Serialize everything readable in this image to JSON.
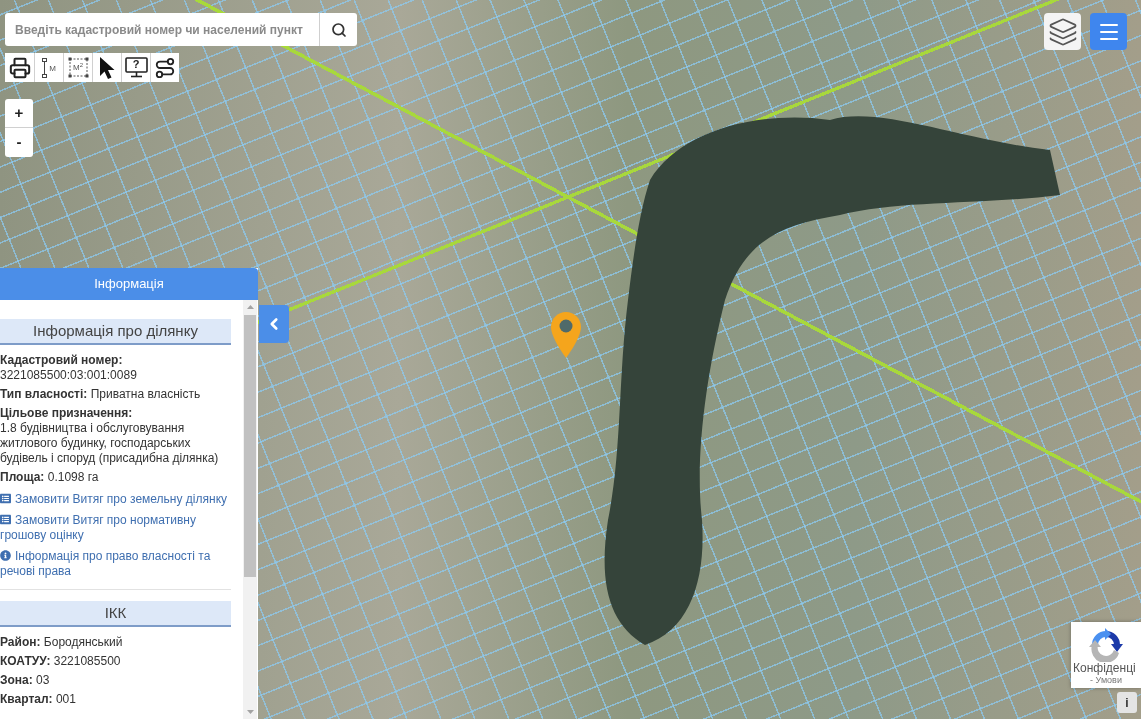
{
  "search": {
    "placeholder": "Введіть кадастровий номер чи населений пункт"
  },
  "tools": [
    {
      "kind": "print"
    },
    {
      "kind": "distance",
      "label": "M"
    },
    {
      "kind": "area",
      "label": "M$^{2}$"
    },
    {
      "kind": "select"
    },
    {
      "kind": "help",
      "label": "?"
    },
    {
      "kind": "route"
    }
  ],
  "zoom": {
    "in": "+",
    "out": "-"
  },
  "panel": {
    "title": "Інформація",
    "sections": [
      {
        "heading": "Інформація про ділянку",
        "fields": [
          {
            "label": "Кадастровий номер:",
            "value": "3221085500:03:001:0089"
          },
          {
            "label": "Тип власності:",
            "value": "Приватна власність"
          },
          {
            "label": "Цільове призначення:",
            "value": "1.8 будівництва і обслуговування житлового будинку, господарських будівель і споруд (присадибна ділянка)"
          },
          {
            "label": "Площа:",
            "value": "0.1098 га"
          }
        ],
        "links": [
          {
            "kind": "document",
            "text": "Замовити Витяг про земельну ділянку"
          },
          {
            "kind": "document",
            "text": "Замовити Витяг про нормативну грошову оцінку"
          },
          {
            "kind": "info",
            "text": "Інформація про право власності та речові права"
          }
        ]
      },
      {
        "heading": "ІКК",
        "fields": [
          {
            "label": "Район:",
            "value": "Бородянський"
          },
          {
            "label": "КОАТУУ:",
            "value": "3221085500"
          },
          {
            "label": "Зона:",
            "value": "03"
          },
          {
            "label": "Квартал:",
            "value": "001"
          }
        ]
      }
    ]
  },
  "recaptcha": {
    "privacy": "Конфіденці",
    "terms": "- Умови"
  },
  "info_button": {
    "label": "i"
  }
}
